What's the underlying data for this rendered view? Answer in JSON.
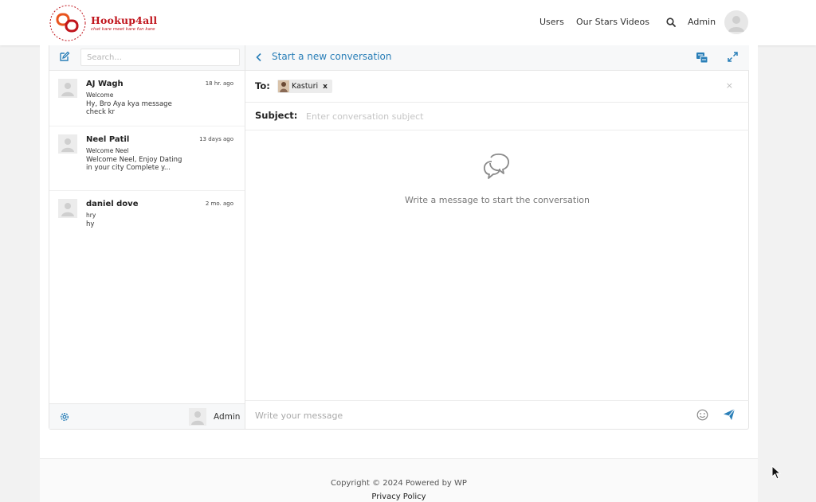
{
  "brand": {
    "name": "Hookup4all",
    "tagline": "chat kare meet kare fun kare",
    "accent": "#c0141c"
  },
  "nav": {
    "users": "Users",
    "videos": "Our Stars Videos",
    "search_icon": "search-icon",
    "admin": "Admin"
  },
  "sidebar": {
    "search_placeholder": "Search...",
    "threads": [
      {
        "name": "AJ Wagh",
        "time": "18 hr. ago",
        "subject": "Welcome",
        "preview": "Hy, Bro Aya kya message check kr"
      },
      {
        "name": "Neel Patil",
        "time": "13 days ago",
        "subject": "Welcome Neel",
        "preview": "Welcome Neel, Enjoy Dating in your city Complete y..."
      },
      {
        "name": "daniel dove",
        "time": "2 mo. ago",
        "subject": "hry",
        "preview": "hy"
      }
    ],
    "footer_user": "Admin"
  },
  "pane": {
    "title": "Start a new conversation",
    "accent": "#2a7fb8",
    "to_label": "To:",
    "recipient": "Kasturi",
    "chip_remove": "x",
    "clear": "×",
    "subject_label": "Subject:",
    "subject_placeholder": "Enter conversation subject",
    "empty_text": "Write a message to start the conversation",
    "message_placeholder": "Write your message"
  },
  "footer": {
    "copyright": "Copyright © 2024 Powered by WP",
    "privacy": "Privacy Policy"
  }
}
